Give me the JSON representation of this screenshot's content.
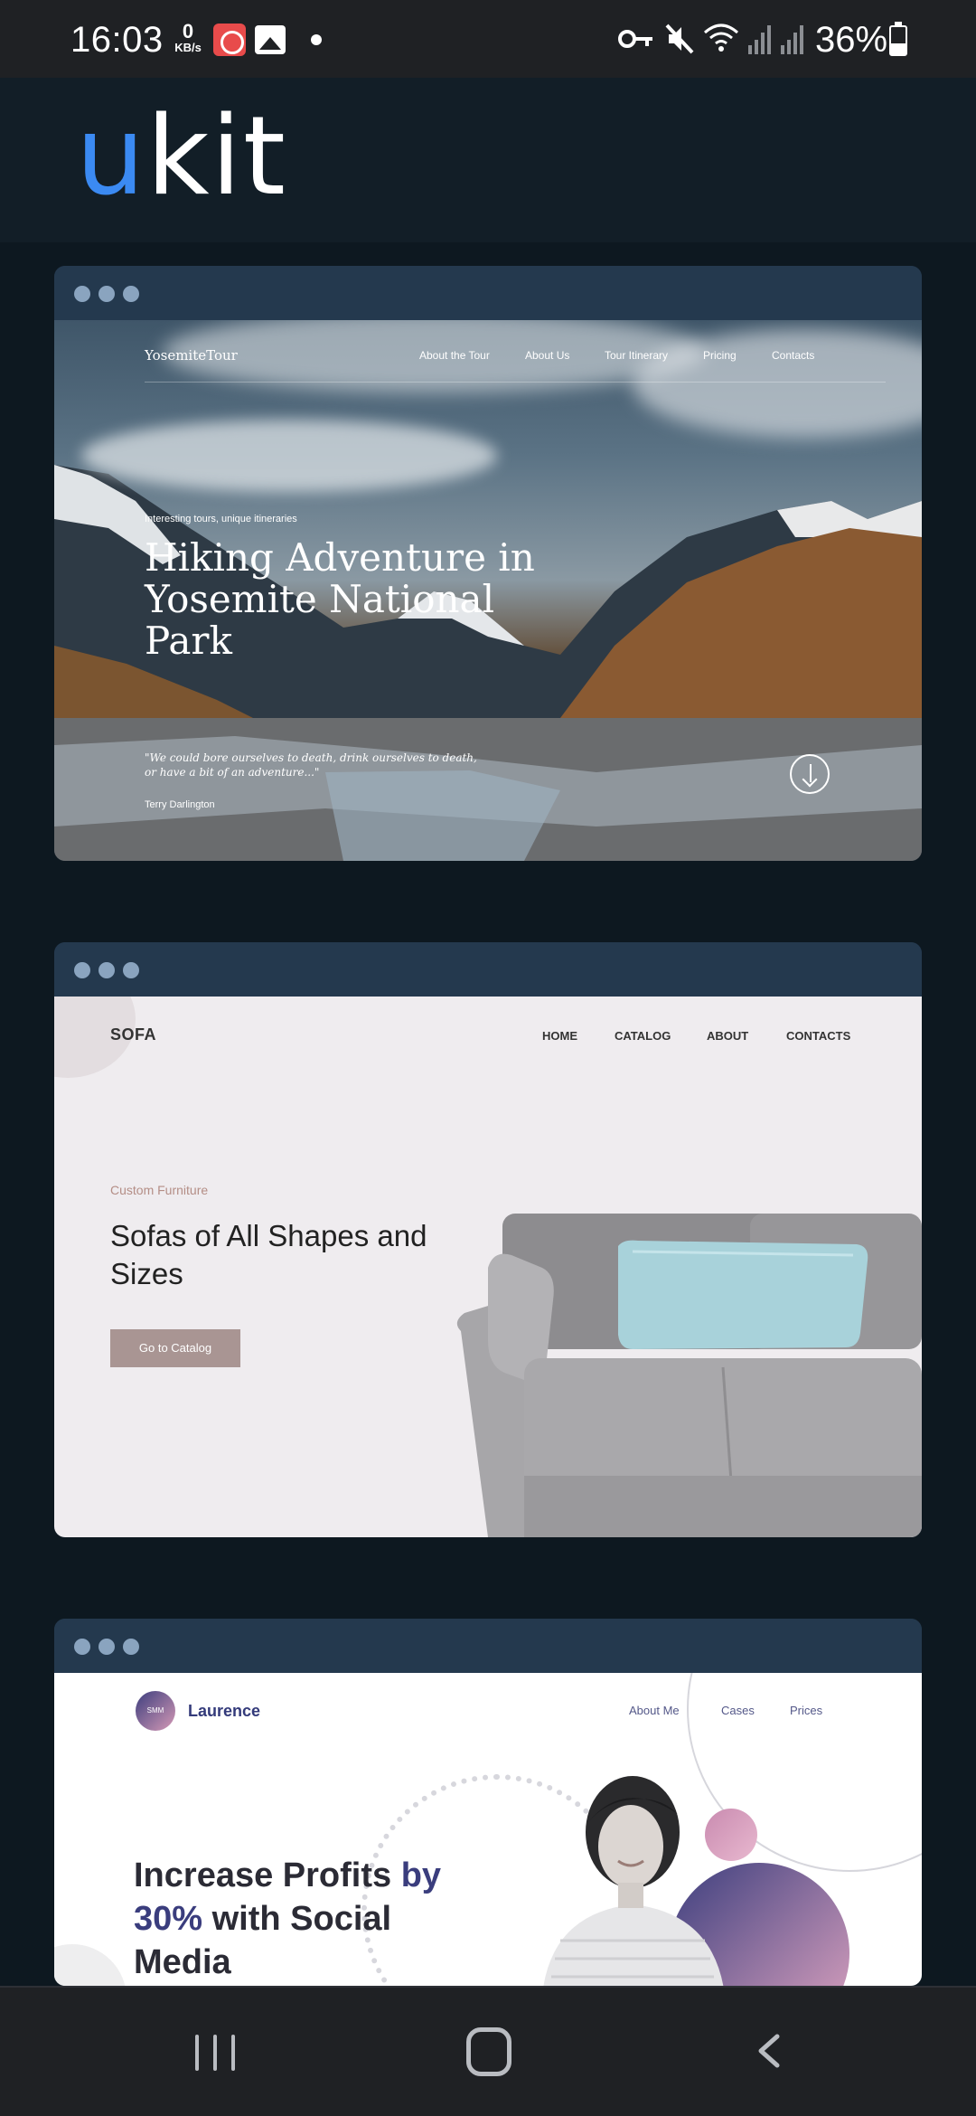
{
  "status_bar": {
    "time": "16:03",
    "net_speed_value": "0",
    "net_speed_unit": "KB/s",
    "battery": "36%",
    "icons": [
      "app-notification-icon",
      "gallery-icon",
      "dot-icon",
      "key-icon",
      "mute-icon",
      "wifi-icon",
      "signal-icon",
      "battery-icon"
    ]
  },
  "header": {
    "logo_accent": "u",
    "logo_rest": "kit",
    "colors": {
      "accent": "#3b8af2",
      "background": "#121e27"
    }
  },
  "templates": [
    {
      "brand": "YosemiteTour",
      "nav": [
        "About the Tour",
        "About Us",
        "Tour Itinerary",
        "Pricing",
        "Contacts"
      ],
      "kicker": "Interesting tours, unique itineraries",
      "title": "Hiking Adventure in Yosemite National Park",
      "quote": "\"We could bore ourselves to death, drink ourselves to death, or have a bit of an adventure...\"",
      "author": "Terry Darlington"
    },
    {
      "brand": "SOFA",
      "nav": [
        "HOME",
        "CATALOG",
        "ABOUT",
        "CONTACTS"
      ],
      "kicker": "Custom Furniture",
      "title": "Sofas of All Shapes and Sizes",
      "button": "Go to Catalog"
    },
    {
      "logo_badge": "SMM",
      "brand": "Laurence",
      "nav": [
        "About Me",
        "Cases",
        "Prices"
      ],
      "title_part1": "Increase Profits ",
      "title_highlight1": "by 30%",
      "title_part2": " with Social Media"
    }
  ]
}
